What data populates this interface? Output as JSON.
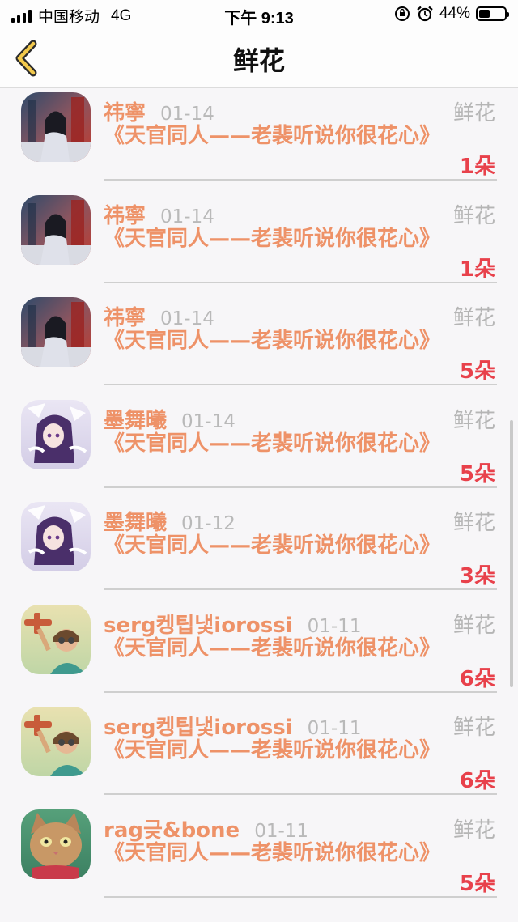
{
  "status_bar": {
    "carrier": "中国移动",
    "network": "4G",
    "time": "下午 9:13",
    "battery_text": "44%",
    "battery_level": 0.44
  },
  "nav": {
    "title": "鲜花",
    "back_icon": "chevron-left-icon",
    "accent_color": "#f2c94c"
  },
  "colors": {
    "name": "#ee9268",
    "date": "#b9b9b9",
    "count": "#e8414b",
    "category": "#b5b5b5"
  },
  "rows": [
    {
      "name": "祎寧",
      "date": "01-14",
      "title": "《天官同人——老裴听说你很花心》",
      "category": "鲜花",
      "count": "1朵",
      "avatar": "avatar-girl-city"
    },
    {
      "name": "祎寧",
      "date": "01-14",
      "title": "《天官同人——老裴听说你很花心》",
      "category": "鲜花",
      "count": "1朵",
      "avatar": "avatar-girl-city"
    },
    {
      "name": "祎寧",
      "date": "01-14",
      "title": "《天官同人——老裴听说你很花心》",
      "category": "鲜花",
      "count": "5朵",
      "avatar": "avatar-girl-city"
    },
    {
      "name": "墨舞曦",
      "date": "01-14",
      "title": "《天官同人——老裴听说你很花心》",
      "category": "鲜花",
      "count": "5朵",
      "avatar": "avatar-anime-purple"
    },
    {
      "name": "墨舞曦",
      "date": "01-12",
      "title": "《天官同人——老裴听说你很花心》",
      "category": "鲜花",
      "count": "3朵",
      "avatar": "avatar-anime-purple"
    },
    {
      "name": "serg켕팁냋iorossi",
      "date": "01-11",
      "title": "《天官同人——老裴听说你很花心》",
      "category": "鲜花",
      "count": "6朵",
      "avatar": "avatar-pilot-kid"
    },
    {
      "name": "serg켕팁냋iorossi",
      "date": "01-11",
      "title": "《天官同人——老裴听说你很花心》",
      "category": "鲜花",
      "count": "6朵",
      "avatar": "avatar-pilot-kid"
    },
    {
      "name": "rag긎&bone",
      "date": "01-11",
      "title": "《天官同人——老裴听说你很花心》",
      "category": "鲜花",
      "count": "5朵",
      "avatar": "avatar-cat"
    }
  ]
}
